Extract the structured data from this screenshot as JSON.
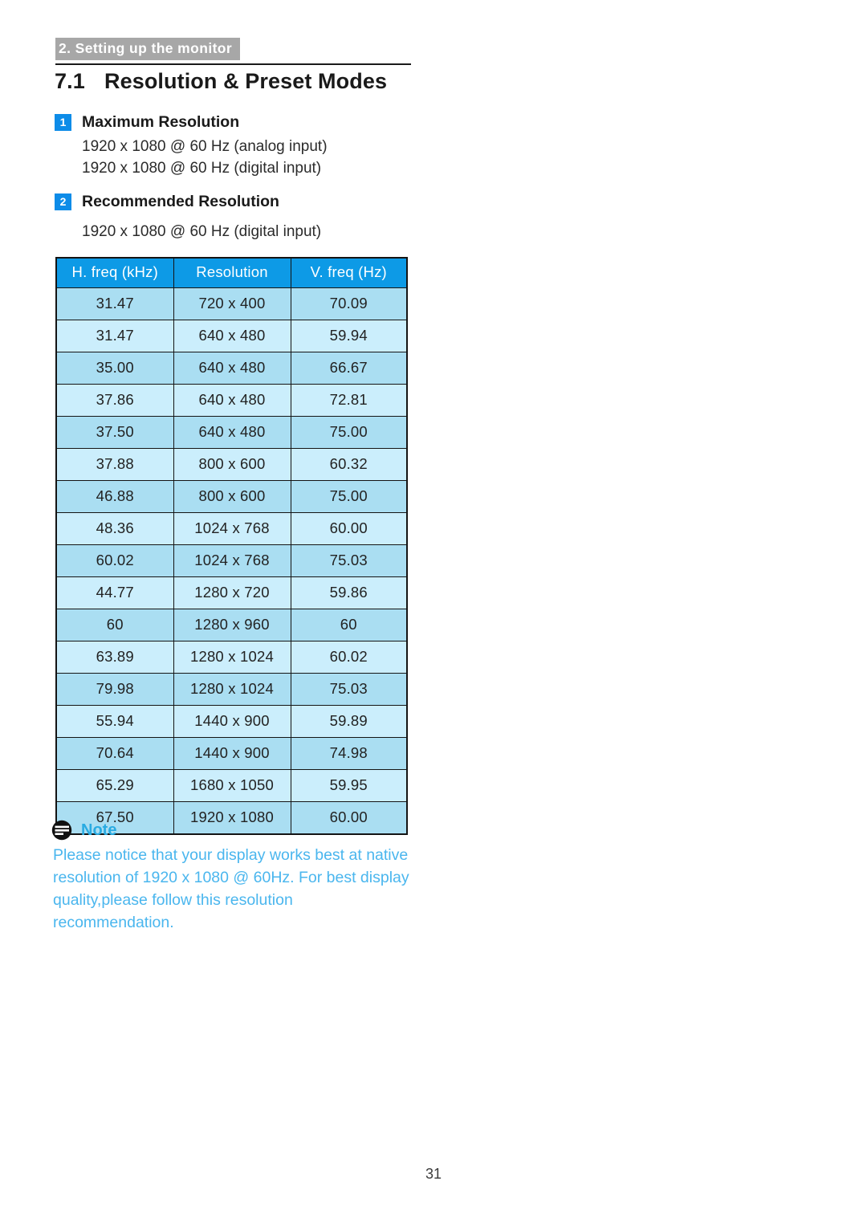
{
  "header": {
    "chapter_tab": "2. Setting up the monitor"
  },
  "section": {
    "number": "7.1",
    "title": "Resolution & Preset Modes"
  },
  "items": [
    {
      "badge": "1",
      "label": "Maximum Resolution",
      "lines": [
        "1920 x 1080 @ 60 Hz (analog input)",
        "1920 x 1080 @ 60 Hz (digital input)"
      ]
    },
    {
      "badge": "2",
      "label": "Recommended Resolution",
      "lines": [
        "1920 x 1080 @ 60 Hz (digital input)"
      ]
    }
  ],
  "table": {
    "columns": [
      "H. freq (kHz)",
      "Resolution",
      "V. freq (Hz)"
    ],
    "rows": [
      [
        "31.47",
        "720 x 400",
        "70.09"
      ],
      [
        "31.47",
        "640 x 480",
        "59.94"
      ],
      [
        "35.00",
        "640 x 480",
        "66.67"
      ],
      [
        "37.86",
        "640 x 480",
        "72.81"
      ],
      [
        "37.50",
        "640 x 480",
        "75.00"
      ],
      [
        "37.88",
        "800 x 600",
        "60.32"
      ],
      [
        "46.88",
        "800 x 600",
        "75.00"
      ],
      [
        "48.36",
        "1024 x 768",
        "60.00"
      ],
      [
        "60.02",
        "1024 x 768",
        "75.03"
      ],
      [
        "44.77",
        "1280 x 720",
        "59.86"
      ],
      [
        "60",
        "1280 x 960",
        "60"
      ],
      [
        "63.89",
        "1280 x 1024",
        "60.02"
      ],
      [
        "79.98",
        "1280 x 1024",
        "75.03"
      ],
      [
        "55.94",
        "1440 x 900",
        "59.89"
      ],
      [
        "70.64",
        "1440 x 900",
        "74.98"
      ],
      [
        "65.29",
        "1680 x 1050",
        "59.95"
      ],
      [
        "67.50",
        "1920 x 1080",
        "60.00"
      ]
    ]
  },
  "note": {
    "icon": "note-lines-icon",
    "title": "Note",
    "body": "Please notice that your display works best at native resolution of 1920 x 1080 @ 60Hz. For best display quality,please follow this resolution recommendation."
  },
  "footer": {
    "page_number": "31"
  },
  "colors": {
    "chapter_tab_bg": "#a7a7a7",
    "badge_bg": "#0d8ce8",
    "table_header_bg": "#0d9ae6",
    "row_band_a": "#aadef2",
    "row_band_b": "#cbeefc",
    "note_accent": "#29abe2",
    "note_text": "#4ab6ee",
    "rule": "#1a1a1a"
  }
}
